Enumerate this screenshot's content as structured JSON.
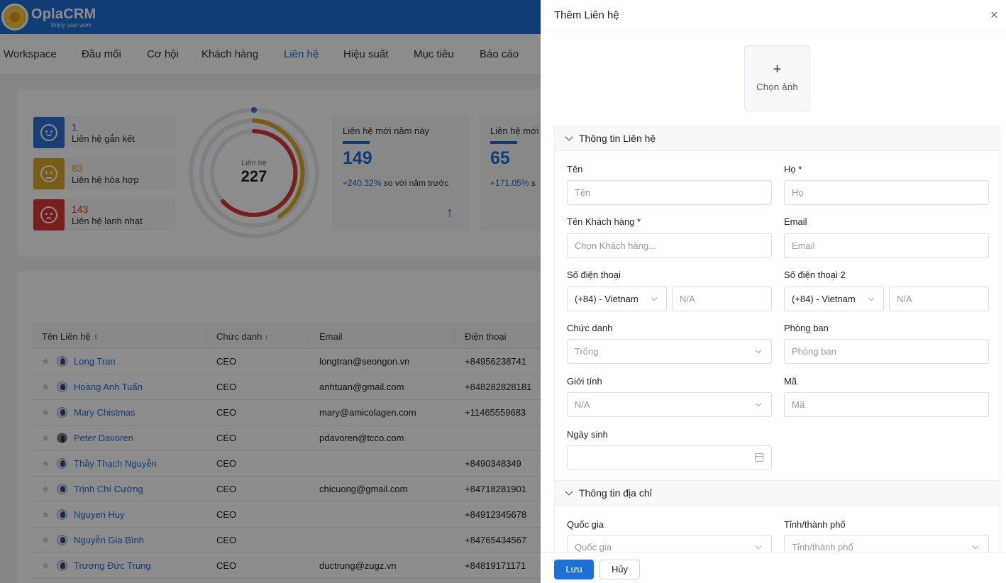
{
  "app": {
    "name": "OplaCRM",
    "tagline": "Enjoy your work",
    "brand_color": "#1f6fd9"
  },
  "nav": {
    "items": [
      {
        "label": "Workspace"
      },
      {
        "label": "Đầu mối"
      },
      {
        "label": "Cơ hội"
      },
      {
        "label": "Khách hàng"
      },
      {
        "label": "Liên hệ",
        "active": true
      },
      {
        "label": "Hiệu suất"
      },
      {
        "label": "Mục tiêu"
      },
      {
        "label": "Báo cáo"
      }
    ]
  },
  "stats": {
    "levels": [
      {
        "count": "1",
        "label": "Liên hệ gắn kết",
        "color": "#2f6fd6",
        "icon": "smile-icon"
      },
      {
        "count": "83",
        "label": "Liên hệ hòa hợp",
        "color": "#d9a92b",
        "icon": "neutral-face-icon"
      },
      {
        "count": "143",
        "label": "Liên hệ lạnh nhạt",
        "color": "#d93838",
        "icon": "sad-face-icon"
      }
    ],
    "donut": {
      "title": "Liên hệ",
      "total": "227"
    },
    "metrics": [
      {
        "title": "Liên hệ mới năm này",
        "value": "149",
        "delta_pct": "+240.32%",
        "delta_text": " so với năm trước"
      },
      {
        "title": "Liên hệ mới",
        "value": "65",
        "delta_pct": "+171.05%",
        "delta_text": " s"
      }
    ]
  },
  "table": {
    "columns": [
      "Tên Liên hệ",
      "Chức danh",
      "Email",
      "Điện thoại"
    ],
    "rows": [
      {
        "name": "Long Tran",
        "title": "CEO",
        "email": "longtran@seongon.vn",
        "phone": "+84956238741"
      },
      {
        "name": "Hoàng Anh Tuấn",
        "title": "CEO",
        "email": "anhtuan@gmail.com",
        "phone": "+848282828181"
      },
      {
        "name": "Mary Chistmas",
        "title": "CEO",
        "email": "mary@amicolagen.com",
        "phone": "+11465559683"
      },
      {
        "name": "Peter Davoren",
        "title": "CEO",
        "email": "pdavoren@tcco.com",
        "phone": ""
      },
      {
        "name": "Thầy Thạch Nguyễn",
        "title": "CEO",
        "email": "",
        "phone": "+8490348349"
      },
      {
        "name": "Trịnh Chí Cường",
        "title": "CEO",
        "email": "chicuong@gmail.com",
        "phone": "+84718281901"
      },
      {
        "name": "Nguyen Huy",
        "title": "CEO",
        "email": "",
        "phone": "+84912345678"
      },
      {
        "name": "Nguyễn Gia Bình",
        "title": "CEO",
        "email": "",
        "phone": "+84765434567"
      },
      {
        "name": "Trương Đức Trung",
        "title": "CEO",
        "email": "ductrung@zugz.vn",
        "phone": "+84819171171"
      }
    ]
  },
  "drawer": {
    "title": "Thêm Liên hệ",
    "close_icon": "×",
    "avatar": {
      "plus": "+",
      "label": "Chọn ảnh"
    },
    "contact_section": {
      "title": "Thông tin Liên hệ",
      "first_name": {
        "label": "Tên",
        "placeholder": "Tên"
      },
      "last_name": {
        "label": "Họ *",
        "placeholder": "Họ"
      },
      "customer": {
        "label": "Tên Khách hàng *",
        "placeholder": "Chọn Khách hàng..."
      },
      "email": {
        "label": "Email",
        "placeholder": "Email"
      },
      "phone": {
        "label": "Số điện thoại",
        "country": "(+84) - Vietnam",
        "placeholder": "N/A"
      },
      "phone2": {
        "label": "Số điện thoại 2",
        "country": "(+84) - Vietnam",
        "placeholder": "N/A"
      },
      "job_title": {
        "label": "Chức danh",
        "value": "Trống"
      },
      "department": {
        "label": "Phòng ban",
        "placeholder": "Phòng ban"
      },
      "gender": {
        "label": "Giới tính",
        "value": "N/A"
      },
      "code": {
        "label": "Mã",
        "placeholder": "Mã"
      },
      "birthday": {
        "label": "Ngày sinh"
      }
    },
    "address_section": {
      "title": "Thông tin địa chỉ",
      "country": {
        "label": "Quốc gia",
        "placeholder": "Quốc gia"
      },
      "province": {
        "label": "Tỉnh/thành phố",
        "placeholder": "Tỉnh/thành phố"
      }
    },
    "footer": {
      "save": "Lưu",
      "cancel": "Hủy"
    }
  }
}
